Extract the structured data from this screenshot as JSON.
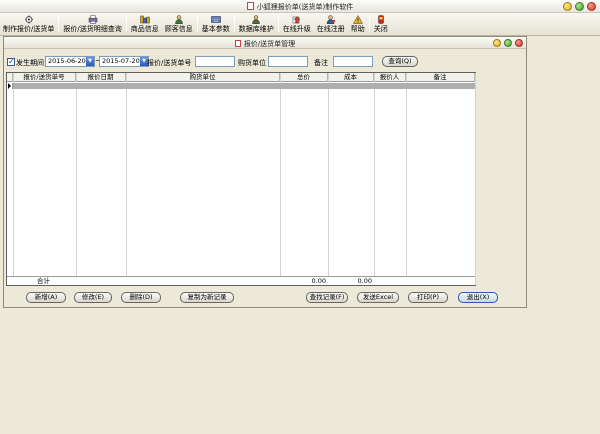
{
  "app": {
    "title": "小狐狸报价单(送货单)制作软件"
  },
  "toolbar": {
    "items": [
      {
        "id": "make-quote",
        "label": "制作报价/送货单",
        "icon": "cursor-gear-icon"
      },
      {
        "id": "detail-query",
        "label": "报价/送货明细查询",
        "icon": "printer-search-icon"
      },
      {
        "id": "goods",
        "label": "商品信息",
        "icon": "boxes-icon"
      },
      {
        "id": "customer",
        "label": "顾客信息",
        "icon": "person-icon"
      },
      {
        "id": "params",
        "label": "基本参数",
        "icon": "keyboard-icon"
      },
      {
        "id": "db",
        "label": "数据库维护",
        "icon": "db-person-icon"
      },
      {
        "id": "upgrade",
        "label": "在线升级",
        "icon": "upgrade-icon"
      },
      {
        "id": "register",
        "label": "在线注册",
        "icon": "register-person-icon"
      },
      {
        "id": "help",
        "label": "帮助",
        "icon": "help-icon"
      },
      {
        "id": "close",
        "label": "关闭",
        "icon": "exit-icon"
      }
    ]
  },
  "child": {
    "title": "报价/送货单管理"
  },
  "filter": {
    "date_label": "发生期间",
    "date_from": "2015-06-20",
    "date_to": "2015-07-20",
    "tilde": "~",
    "order_no_label": "报价/送货单号",
    "order_no_value": "",
    "buyer_label": "购货单位",
    "buyer_value": "",
    "remark_label": "备注",
    "remark_value": "",
    "query_btn": "查询(Q)"
  },
  "grid": {
    "columns": [
      "报价/送货单号",
      "报价日期",
      "购货单位",
      "总价",
      "成本",
      "报价人",
      "备注"
    ],
    "total_label": "合计",
    "total_price": "0.00",
    "total_cost": "0.00"
  },
  "actions": {
    "add": "新增(A)",
    "edit": "修改(E)",
    "delete": "删除(D)",
    "copy": "复制为新记录",
    "find": "查找记录(F)",
    "excel": "发送Excel",
    "print": "打印(P)",
    "exit": "退出(X)"
  }
}
